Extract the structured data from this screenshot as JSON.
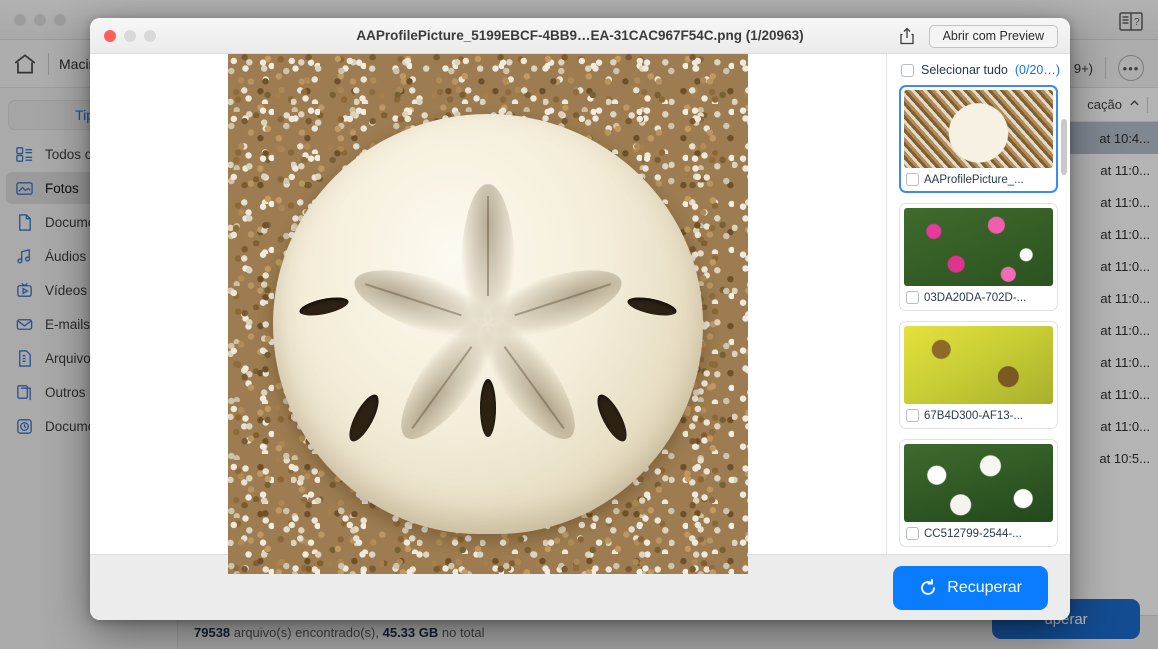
{
  "background_app": {
    "breadcrumb": "Macint",
    "home_icon": "home-icon",
    "filter_pill": "Tipo",
    "sidebar_items": [
      {
        "label": "Todos o",
        "icon": "list-icon"
      },
      {
        "label": "Fotos",
        "icon": "photo-icon"
      },
      {
        "label": "Docume",
        "icon": "document-icon"
      },
      {
        "label": "Áudios",
        "icon": "audio-icon"
      },
      {
        "label": "Vídeos",
        "icon": "video-icon"
      },
      {
        "label": "E-mails",
        "icon": "mail-icon"
      },
      {
        "label": "Arquivo",
        "icon": "archive-icon"
      },
      {
        "label": "Outros",
        "icon": "others-icon"
      },
      {
        "label": "Docume",
        "icon": "recent-document-icon"
      }
    ],
    "active_sidebar_item": "Fotos",
    "count_badge": "9+)",
    "more_icon": "ellipsis-icon",
    "column_header": "cação",
    "sort_icon": "chevron-up-icon",
    "rows": [
      {
        "time": "at 10:4...",
        "selected": true
      },
      {
        "time": "at 11:0...",
        "selected": false
      },
      {
        "time": "at 11:0...",
        "selected": false
      },
      {
        "time": "at 11:0...",
        "selected": false
      },
      {
        "time": "at 11:0...",
        "selected": false
      },
      {
        "time": "at 11:0...",
        "selected": false
      },
      {
        "time": "at 11:0...",
        "selected": false
      },
      {
        "time": "at 11:0...",
        "selected": false
      },
      {
        "time": "at 11:0...",
        "selected": false
      },
      {
        "time": "at 11:0...",
        "selected": false
      },
      {
        "time": "at 10:5...",
        "selected": false
      }
    ],
    "recover_button": "uperar",
    "status_count": "79538",
    "status_middle": " arquivo(s) encontrado(s), ",
    "status_size": "45.33 GB",
    "status_tail": " no total",
    "help_icon": "book-help-icon"
  },
  "modal": {
    "title": "AAProfilePicture_5199EBCF-4BB9…EA-31CAC967F54C.png (1/20963)",
    "share_icon": "share-icon",
    "open_with_label": "Abrir com Preview",
    "close_icon": "close-window-icon",
    "minimize_icon": "minimize-window-icon",
    "zoom_icon": "zoom-window-icon",
    "preview_alt": "sand-dollar-on-beach-sand",
    "select_all_label": "Selecionar tudo ",
    "select_all_count": "(0/20…)",
    "thumbnails": [
      {
        "label": "AAProfilePicture_...",
        "selected": true,
        "style": "tm0"
      },
      {
        "label": "03DA20DA-702D-...",
        "selected": false,
        "style": "tm1"
      },
      {
        "label": "67B4D300-AF13-...",
        "selected": false,
        "style": "tm2"
      },
      {
        "label": "CC512799-2544-...",
        "selected": false,
        "style": "tm3"
      },
      {
        "label": "",
        "selected": false,
        "style": "tm4"
      }
    ],
    "recover_button": "Recuperar",
    "recover_icon": "refresh-icon"
  },
  "colors": {
    "accent_blue": "#0a7cff",
    "link_blue": "#1273e8",
    "selection_border": "#3d8bf2",
    "row_selected": "#aab6c6"
  }
}
